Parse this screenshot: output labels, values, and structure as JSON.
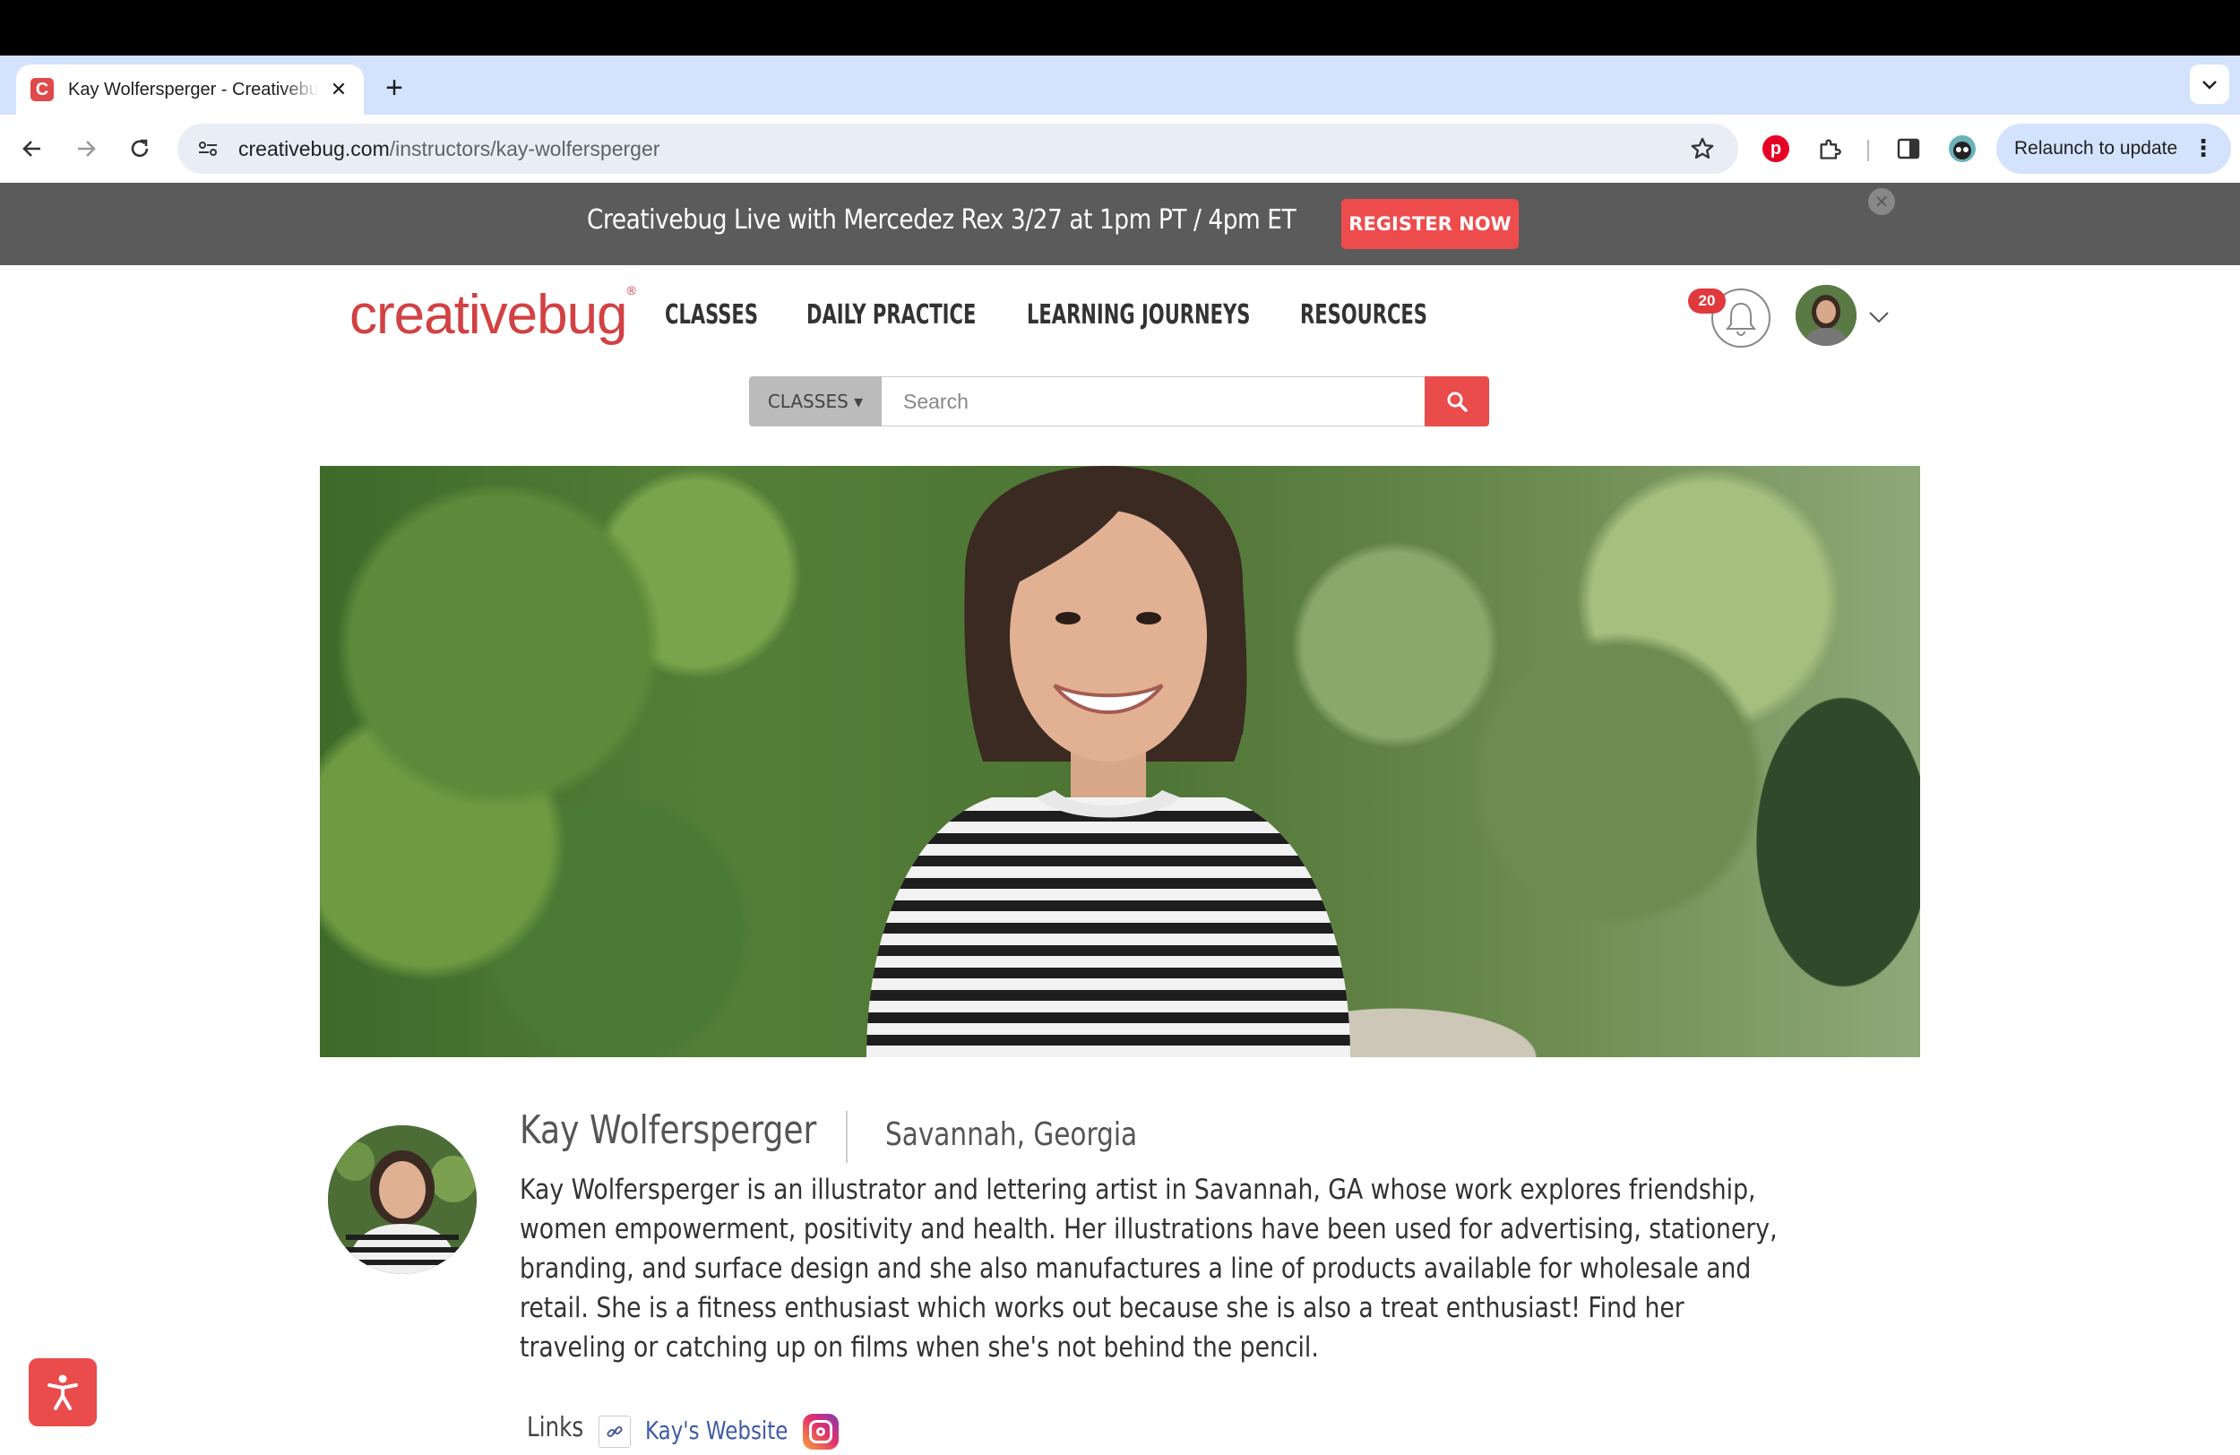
{
  "browser": {
    "tab_title": "Kay Wolfersperger - Creativebug",
    "tab_favicon": "C",
    "url_domain": "creativebug.com",
    "url_path": "/instructors/kay-wolfersperger",
    "relaunch_label": "Relaunch to update"
  },
  "announcement": {
    "text": "Creativebug Live with Mercedez Rex 3/27 at 1pm PT / 4pm ET",
    "button_label": "REGISTER NOW"
  },
  "header": {
    "logo": "creativebug",
    "logo_mark": "®",
    "nav": [
      "CLASSES",
      "DAILY PRACTICE",
      "LEARNING JOURNEYS",
      "RESOURCES"
    ],
    "notification_count": "20"
  },
  "search": {
    "category": "CLASSES ▾",
    "placeholder": "Search"
  },
  "profile": {
    "name": "Kay Wolfersperger",
    "location": "Savannah, Georgia",
    "bio": "Kay Wolfersperger is an illustrator and lettering artist in Savannah, GA whose work explores friendship, women empowerment, positivity and health. Her illustrations have been used for advertising, stationery, branding, and surface design and she also manufactures a line of products available for wholesale and retail. She is a fitness enthusiast which works out because she is also a treat enthusiast! Find her traveling or catching up on films when she's not behind the pencil.",
    "links_label": "Links",
    "website_label": "Kay's Website"
  },
  "colors": {
    "brand_red": "#d24143",
    "button_red": "#ea4b4b",
    "announce_bg": "#5b5b5b"
  },
  "icons": [
    "back-icon",
    "forward-icon",
    "reload-icon",
    "site-info-icon",
    "star-icon",
    "pinterest-icon",
    "extensions-icon",
    "sidepanel-icon",
    "profile-ext-icon",
    "kebab-icon",
    "bell-icon",
    "search-icon",
    "link-icon",
    "instagram-icon",
    "accessibility-icon",
    "chevron-down-icon",
    "close-icon"
  ]
}
